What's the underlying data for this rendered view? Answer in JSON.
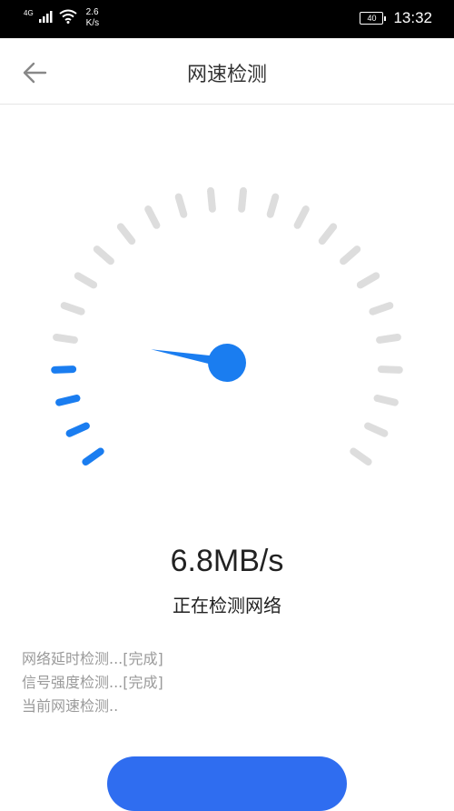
{
  "status_bar": {
    "network_type": "4G",
    "speed_line1": "2.6",
    "speed_line2": "K/s",
    "battery_level": "40",
    "time": "13:32"
  },
  "header": {
    "title": "网速检测",
    "back_icon": "arrow-left-icon"
  },
  "gauge": {
    "tick_count": 24,
    "active_ticks": 4,
    "needle_fraction": 0.18,
    "active_color": "#1a7df0",
    "inactive_color": "#dddddd"
  },
  "result": {
    "speed": "6.8MB/s",
    "status": "正在检测网络"
  },
  "log": {
    "lines": [
      "网络延时检测...[完成]",
      "信号强度检测...[完成]",
      "当前网速检测.."
    ]
  },
  "colors": {
    "accent": "#1a7df0",
    "button": "#2f6df0"
  }
}
